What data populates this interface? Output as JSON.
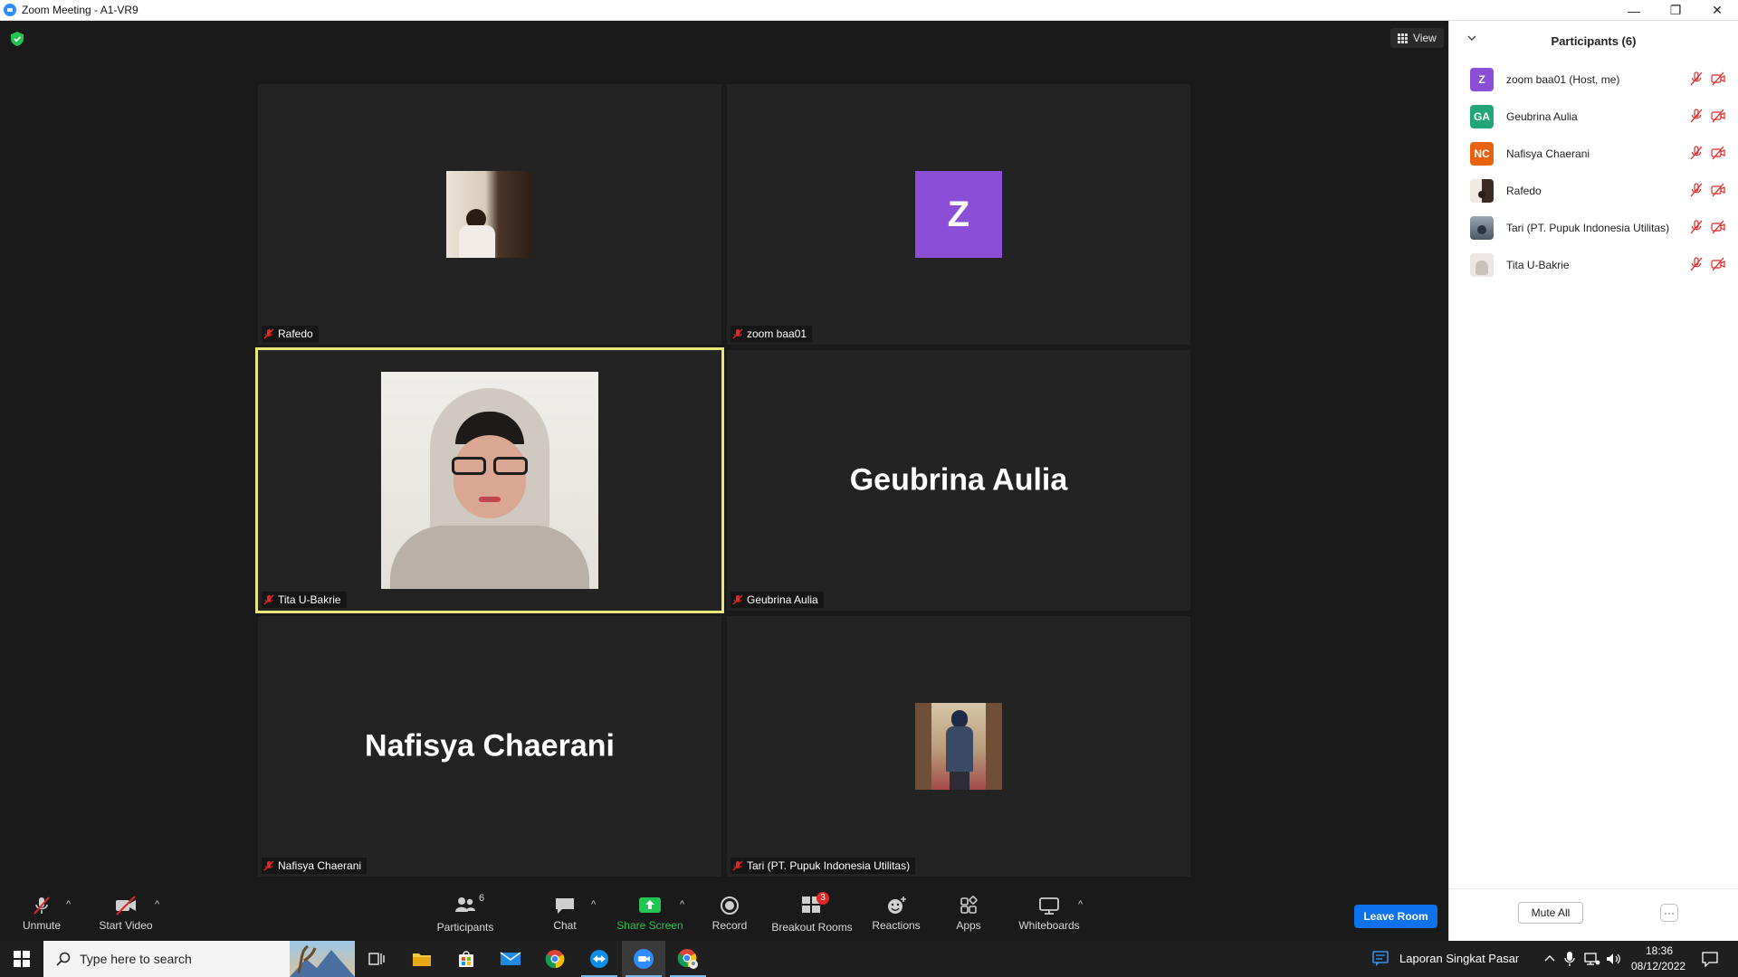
{
  "window": {
    "title": "Zoom Meeting - A1-VR9",
    "minimize_glyph": "—",
    "restore_glyph": "❐",
    "close_glyph": "✕"
  },
  "meeting": {
    "view_label": "View",
    "tiles": [
      {
        "name": "Rafedo",
        "type": "photo"
      },
      {
        "name": "zoom baa01",
        "type": "avatar",
        "initial": "Z",
        "color": "#8a4fd6"
      },
      {
        "name": "Tita U-Bakrie",
        "type": "photo",
        "active": true
      },
      {
        "name": "Geubrina Aulia",
        "type": "name",
        "big": "Geubrina Aulia"
      },
      {
        "name": "Nafisya Chaerani",
        "type": "name",
        "big": "Nafisya Chaerani"
      },
      {
        "name": "Tari (PT. Pupuk Indonesia Utilitas)",
        "type": "photo"
      }
    ]
  },
  "toolbar": {
    "unmute": "Unmute",
    "start_video": "Start Video",
    "participants": "Participants",
    "participants_count": "6",
    "chat": "Chat",
    "share_screen": "Share Screen",
    "record": "Record",
    "breakout_rooms": "Breakout Rooms",
    "breakout_badge": "3",
    "reactions": "Reactions",
    "apps": "Apps",
    "whiteboards": "Whiteboards",
    "leave_room": "Leave Room"
  },
  "panel": {
    "title": "Participants (6)",
    "participants": [
      {
        "name": "zoom baa01 (Host, me)",
        "initials": "Z",
        "color": "#8a4fd6"
      },
      {
        "name": "Geubrina Aulia",
        "initials": "GA",
        "color": "#23a57a"
      },
      {
        "name": "Nafisya Chaerani",
        "initials": "NC",
        "color": "#e8620f"
      },
      {
        "name": "Rafedo",
        "initials": "",
        "color": "#c9b9a5"
      },
      {
        "name": "Tari (PT. Pupuk Indonesia Utilitas)",
        "initials": "",
        "color": "#7c8a9a"
      },
      {
        "name": "Tita U-Bakrie",
        "initials": "",
        "color": "#d9d0cc"
      }
    ],
    "mute_all": "Mute All",
    "more": "···"
  },
  "taskbar": {
    "search_placeholder": "Type here to search",
    "notification_text": "Laporan Singkat Pasar",
    "time": "18:36",
    "date": "08/12/2022"
  },
  "colors": {
    "zoom_blue": "#0e72ed",
    "share_green": "#23c552",
    "mute_red": "#e02828",
    "active_speaker": "#e9e77a"
  }
}
